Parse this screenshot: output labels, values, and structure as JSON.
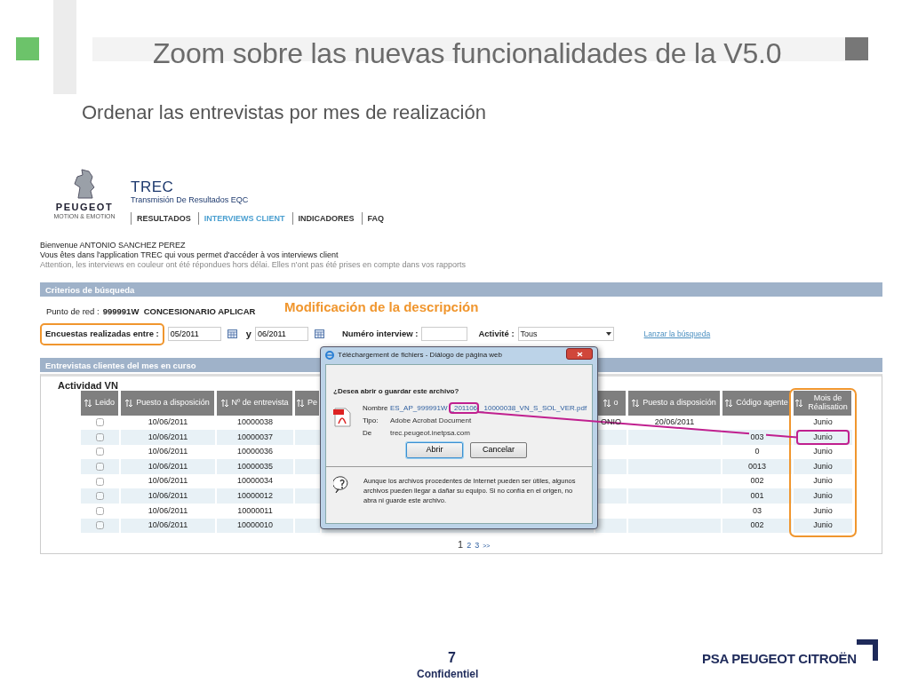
{
  "slide": {
    "title": "Zoom sobre las nuevas funcionalidades de la V5.0",
    "subtitle": "Ordenar las entrevistas por mes de realización",
    "page_number": "7",
    "footer_label": "Confidentiel",
    "logo_text": "PSA PEUGEOT CITROËN"
  },
  "app": {
    "brand": {
      "logo_name": "PEUGEOT",
      "logo_tagline": "MOTION & EMOTION",
      "title": "TREC",
      "subtitle": "Transmisión De Resultados EQC"
    },
    "nav": [
      {
        "label": "RESULTADOS",
        "selected": false
      },
      {
        "label": "INTERVIEWS CLIENT",
        "selected": true
      },
      {
        "label": "INDICADORES",
        "selected": false
      },
      {
        "label": "FAQ",
        "selected": false
      }
    ],
    "welcome": [
      "Bienvenue ANTONIO SANCHEZ PEREZ",
      "Vous êtes dans l'application TREC qui vous permet d'accéder à vos interviews client"
    ],
    "notice": "Attention, les interviews en couleur ont été répondues hors délai. Elles n'ont pas été prises en compte dans vos rapports",
    "search": {
      "heading": "Criterios de búsqueda",
      "point_label": "Punto de red :",
      "point_value": "999991W  CONCESIONARIO APLICAR",
      "period_label": "Encuestas realizadas entre :",
      "period_highlighted": true,
      "from": "05/2011",
      "and_label": "y",
      "to": "06/2011",
      "interview_label": "Numéro interview :",
      "activity_label": "Activité :",
      "activity_value": "Tous",
      "submit_link": "Lanzar la búsqueda"
    },
    "annotation": "Modificación de la descripción",
    "results": {
      "heading": "Entrevistas clientes del mes en curso",
      "group": "Actividad VN",
      "columns": [
        {
          "label": "Leido",
          "highlighted": false
        },
        {
          "label": "Puesto a disposición",
          "highlighted": false
        },
        {
          "label": "Nº de entrevista",
          "highlighted": false
        },
        {
          "label": "Pe",
          "highlighted": false
        },
        {
          "label": "o",
          "highlighted": false
        },
        {
          "label": "Puesto a disposición",
          "highlighted": false
        },
        {
          "label": "Código agente",
          "highlighted": false
        },
        {
          "label": "Mois de Réalisation",
          "highlighted": true
        }
      ],
      "rows": [
        {
          "highlighted": false,
          "cells": [
            {
              "checked": false
            },
            "10/06/2011",
            "10000038",
            "",
            "ONIO",
            "20/06/2011",
            "",
            "Junio"
          ]
        },
        {
          "highlighted": true,
          "cells": [
            {
              "checked": false
            },
            "10/06/2011",
            "10000037",
            "",
            "",
            "",
            "003",
            "Junio"
          ]
        },
        {
          "highlighted": false,
          "cells": [
            {
              "checked": false
            },
            "10/06/2011",
            "10000036",
            "",
            "",
            "",
            "0",
            "Junio"
          ]
        },
        {
          "highlighted": false,
          "cells": [
            {
              "checked": false
            },
            "10/06/2011",
            "10000035",
            "",
            "",
            "",
            "0013",
            "Junio"
          ]
        },
        {
          "highlighted": false,
          "cells": [
            {
              "checked": false
            },
            "10/06/2011",
            "10000034",
            "",
            "",
            "",
            "002",
            "Junio"
          ]
        },
        {
          "highlighted": false,
          "cells": [
            {
              "checked": false
            },
            "10/06/2011",
            "10000012",
            "",
            "",
            "",
            "001",
            "Junio"
          ]
        },
        {
          "highlighted": false,
          "cells": [
            {
              "checked": false
            },
            "10/06/2011",
            "10000011",
            "",
            "",
            "",
            "03",
            "Junio"
          ]
        },
        {
          "highlighted": false,
          "cells": [
            {
              "checked": false
            },
            "10/06/2011",
            "10000010",
            "",
            "",
            "",
            "002",
            "Junio"
          ]
        }
      ],
      "pages": [
        {
          "label": "1",
          "selected": true
        },
        {
          "label": "2",
          "selected": false
        },
        {
          "label": "3",
          "selected": false
        }
      ],
      "next": ">>"
    }
  },
  "dialog": {
    "title": "Téléchargement de fichiers - Diálogo de página web",
    "question": "¿Desea abrir o guardar este archivo?",
    "fields": [
      {
        "label": "Nombre",
        "parts": [
          {
            "text": "ES_AP_999991W",
            "highlighted": false
          },
          {
            "text": "_201106",
            "highlighted": true
          },
          {
            "text": "_10000038_VN_S_SOL_VER.pdf",
            "highlighted": false
          }
        ]
      },
      {
        "label": "Tipo:",
        "parts": [
          {
            "text": "Adobe Acrobat Document",
            "highlighted": false
          }
        ]
      },
      {
        "label": "De",
        "parts": [
          {
            "text": "trec.peugeot.inetpsa.com",
            "highlighted": false
          }
        ]
      }
    ],
    "buttons": [
      {
        "label": "Abrir",
        "focused": true
      },
      {
        "label": "Cancelar",
        "focused": false
      }
    ],
    "warning": "Aunque los archivos procedentes de Internet pueden ser útiles, algunos archivos pueden llegar a dañar su equipo. Si no confía en el origen, no abra ni guarde este archivo."
  }
}
